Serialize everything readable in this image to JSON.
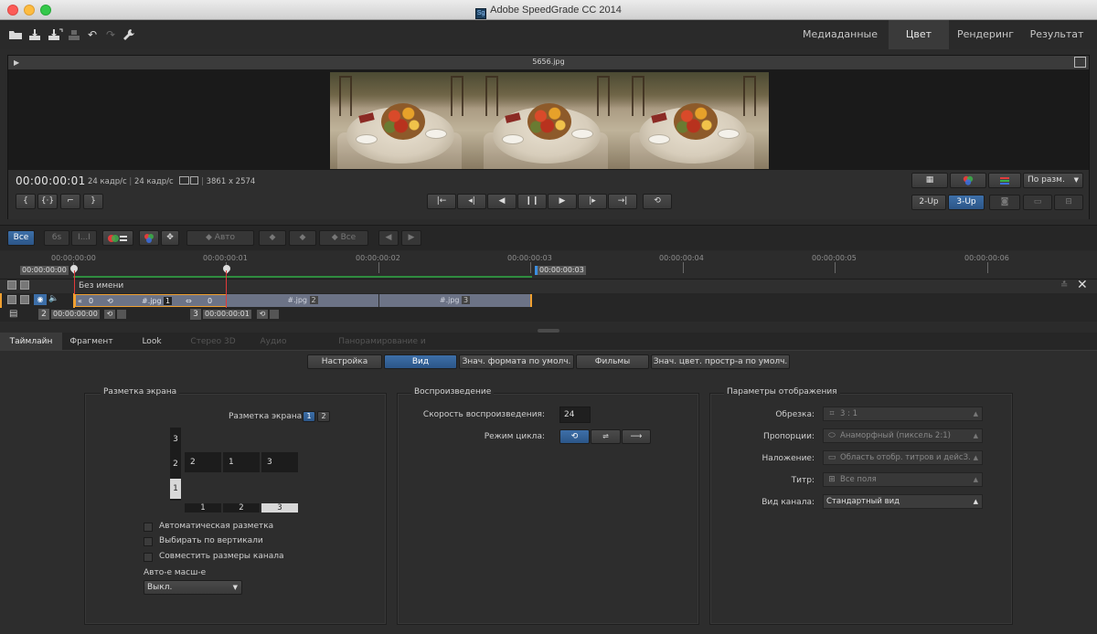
{
  "window": {
    "title": "Adobe SpeedGrade CC 2014",
    "app_icon": "Sg"
  },
  "main_tabs": [
    "Медиаданные",
    "Цвет",
    "Рендеринг",
    "Результат"
  ],
  "main_tab_active": "Цвет",
  "viewer": {
    "filename": "5656.jpg",
    "timecode": "00:00:00:01",
    "fps1": "24 кадр/с",
    "fps2": "24 кадр/с",
    "resolution": "3861 x 2574",
    "fit_select": "По разм.",
    "layout_2up": "2-Up",
    "layout_3up": "3-Up"
  },
  "midbar": {
    "all_button": "Все",
    "six_s": "6s",
    "i_dots": "I...I",
    "auto_button": "Авто",
    "all_button2": "Все"
  },
  "timeline": {
    "ticks": [
      "00:00:00:00",
      "00:00:00:01",
      "00:00:00:02",
      "00:00:00:03",
      "00:00:00:04",
      "00:00:00:05",
      "00:00:00:06"
    ],
    "in_timecode": "00:00:00:00",
    "out_timecode": "00:00:00:03",
    "track_name": "Без имени",
    "clips": [
      {
        "name": "#.jpg",
        "num": "1",
        "in": "0",
        "out": "0"
      },
      {
        "name": "#.jpg",
        "num": "2"
      },
      {
        "name": "#.jpg",
        "num": "3"
      }
    ],
    "audio_marks": [
      {
        "num": "2",
        "tc": "00:00:00:00"
      },
      {
        "num": "3",
        "tc": "00:00:00:01"
      }
    ]
  },
  "lower_tabs": [
    "Таймлайн",
    "Фрагмент",
    "Look",
    "Стерео 3D",
    "Аудио",
    "Панорамирование и сканирование"
  ],
  "lower_tab_active": "Таймлайн",
  "sub_tabs": [
    "Настройка",
    "Вид",
    "Знач. формата по умолч.",
    "Фильмы",
    "Знач. цвет. простр-а по умолч."
  ],
  "sub_tab_active": "Вид",
  "screen_layout": {
    "title": "Разметка экрана",
    "label": "Разметка экрана",
    "pages": [
      "1",
      "2"
    ],
    "rows": [
      "3",
      "2",
      "1"
    ],
    "cols": [
      "1",
      "2",
      "3"
    ],
    "cells": [
      "2",
      "1",
      "3"
    ],
    "checkboxes": [
      "Автоматическая разметка",
      "Выбирать по вертикали",
      "Совместить размеры канала"
    ],
    "auto_scale_label": "Авто-е масш-е",
    "auto_scale_value": "Выкл."
  },
  "playback": {
    "title": "Воспроизведение",
    "speed_label": "Скорость воспроизведения:",
    "speed_value": "24",
    "loop_label": "Режим цикла:"
  },
  "display_params": {
    "title": "Параметры отображения",
    "rows": [
      {
        "label": "Обрезка:",
        "value": "3 : 1",
        "icon": "crop-icon"
      },
      {
        "label": "Пропорции:",
        "value": "Анаморфный (пиксель 2:1)",
        "icon": "aspect-icon"
      },
      {
        "label": "Наложение:",
        "value": "Область отобр. титров и дейсЗ.",
        "icon": "overlay-icon"
      },
      {
        "label": "Титр:",
        "value": "Все поля",
        "icon": "title-icon"
      },
      {
        "label": "Вид канала:",
        "value": "Стандартный вид",
        "icon": ""
      }
    ]
  },
  "colors": {
    "accent": "#2c5688",
    "clip": "#6c7386",
    "playhead": "#e23a3a",
    "selection": "#f0a030"
  }
}
